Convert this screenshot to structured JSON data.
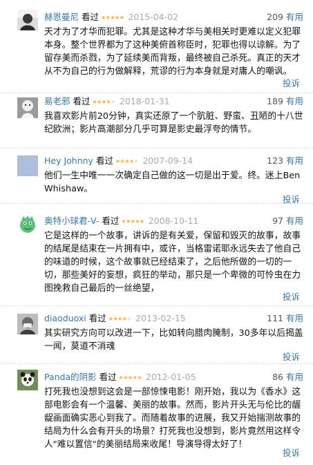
{
  "common": {
    "seen_label": "看过",
    "vote_label": "有用",
    "report_label": "投诉"
  },
  "reviews": [
    {
      "author": "赫恩曼尼",
      "rating": 5,
      "date": "2015-04-02",
      "votes": "209",
      "text": "天才为了才华而犯罪。尤其是这种才华与美相关时更难以定义犯罪本身。整个世界都为了这种美俯首称臣时，犯罪也得以谅解。为了留存美而杀戮，为了延续美而背叛，最终被自己杀死。真正的天才从不为自己的行为做解释，荒谬的行为本身就是对庸人的嘲讽。"
    },
    {
      "author": "易老邪",
      "rating": 4,
      "date": "2018-01-31",
      "votes": "189",
      "text": "我喜欢影片前20分钟，真实还原了一个肮脏、野蛮、丑陋的十八世纪欧洲；影片高潮部分几乎可算是影史最浮夸的情节。"
    },
    {
      "author": "Hey Johnny",
      "rating": 4,
      "date": "2007-09-14",
      "votes": "123",
      "text": "他们一生中唯一一次确定自己做的这一切是出于爱。终。迷上Ben Whishaw。"
    },
    {
      "author": "奥特小球君-V-",
      "rating": 5,
      "date": "2008-10-11",
      "votes": "97",
      "text": "它是这样的一个故事，讲诉的是有关爱，保留和毁灭的故事，故事的结尾是结束在一片拥有中，或许，当格雷诺耶永远失去了他自己的味道的时候，这个故事就已经结束了，之后他所做的一切的一切，那些美好的妄想，疯狂的举动，那只是一个卑微的可怜虫在力图挽救自己最后的一丝绝望，"
    },
    {
      "author": "diaoduoxi",
      "rating": 4,
      "date": "2013-02-15",
      "votes": "111",
      "text": "其实研究方向可以改进一下，比如转向腊肉腌制，30多年以后揭盖一闻，莫道不消魂"
    },
    {
      "author": "Panda的阴影",
      "rating": 5,
      "date": "2012-01-05",
      "votes": "86",
      "text": "打死我也没想到这会是一部惊悚电影！刚开始，我以为《香水》这部电影会有一个温馨、美丽的故事。然而，影片开头无与伦比的龌龊画面确实恶心到我了。而随着故事的进展，我又开始揣测故事的结局为什么会有开头的场景？打死我也没想到，影片竟然用这样令人\"难以置信\"的美丽结局来收尾！导演导得太好了！"
    }
  ]
}
